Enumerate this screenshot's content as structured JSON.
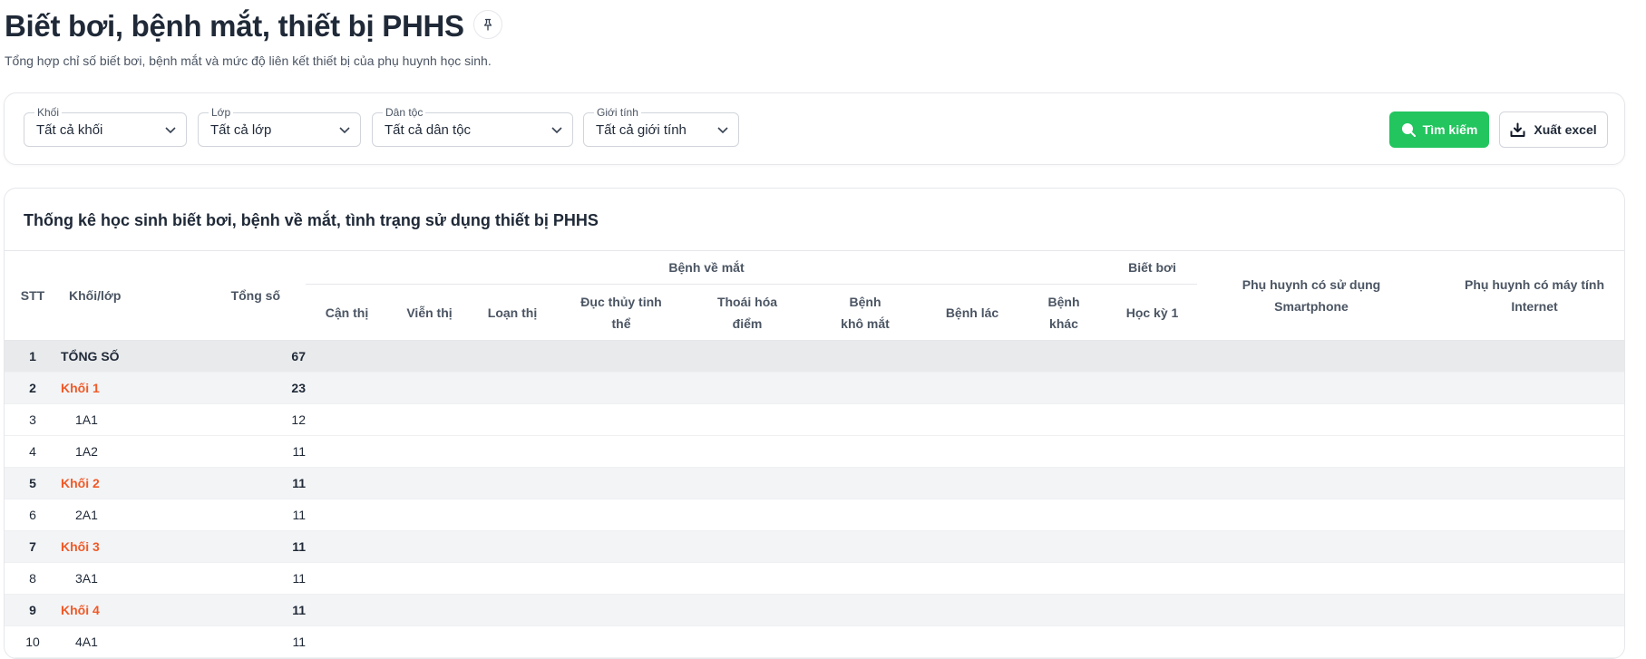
{
  "page": {
    "title": "Biết bơi, bệnh mắt, thiết bị PHHS",
    "subtitle": "Tổng hợp chỉ số biết bơi, bệnh mắt và mức độ liên kết thiết bị của phụ huynh học sinh.",
    "pin_icon": "pin-icon"
  },
  "filters": [
    {
      "label": "Khối",
      "value": "Tất cả khối"
    },
    {
      "label": "Lớp",
      "value": "Tất cả lớp"
    },
    {
      "label": "Dân tộc",
      "value": "Tất cả dân tộc"
    },
    {
      "label": "Giới tính",
      "value": "Tất cả giới tính"
    }
  ],
  "actions": {
    "search_label": "Tìm kiếm",
    "excel_label": "Xuất excel",
    "search_color": "#22c55e"
  },
  "table": {
    "title": "Thống kê học sinh biết bơi, bệnh về mắt, tình trạng sử dụng thiết bị PHHS",
    "headers": {
      "stt": "STT",
      "class": "Khối/lớp",
      "total": "Tổng số",
      "eye_group": "Bệnh về mắt",
      "swim_group": "Biết bơi",
      "eye_cols": [
        "Cận thị",
        "Viễn thị",
        "Loạn thị",
        "Đục thủy tinh thể",
        "Thoái hóa điểm",
        "Bệnh khô mắt",
        "Bệnh lác",
        "Bệnh khác"
      ],
      "swim_col": "Học kỳ 1",
      "smartphone": "Phụ huynh có sử dụng Smartphone",
      "computer": "Phụ huynh có máy tính Internet"
    },
    "rows": [
      {
        "stt": "1",
        "name": "TỔNG SỐ",
        "total": "67",
        "kind": "total"
      },
      {
        "stt": "2",
        "name": "Khối 1",
        "total": "23",
        "kind": "grade"
      },
      {
        "stt": "3",
        "name": "1A1",
        "total": "12",
        "kind": "class"
      },
      {
        "stt": "4",
        "name": "1A2",
        "total": "11",
        "kind": "class"
      },
      {
        "stt": "5",
        "name": "Khối 2",
        "total": "11",
        "kind": "grade"
      },
      {
        "stt": "6",
        "name": "2A1",
        "total": "11",
        "kind": "class"
      },
      {
        "stt": "7",
        "name": "Khối 3",
        "total": "11",
        "kind": "grade"
      },
      {
        "stt": "8",
        "name": "3A1",
        "total": "11",
        "kind": "class"
      },
      {
        "stt": "9",
        "name": "Khối 4",
        "total": "11",
        "kind": "grade"
      },
      {
        "stt": "10",
        "name": "4A1",
        "total": "11",
        "kind": "class"
      }
    ]
  }
}
